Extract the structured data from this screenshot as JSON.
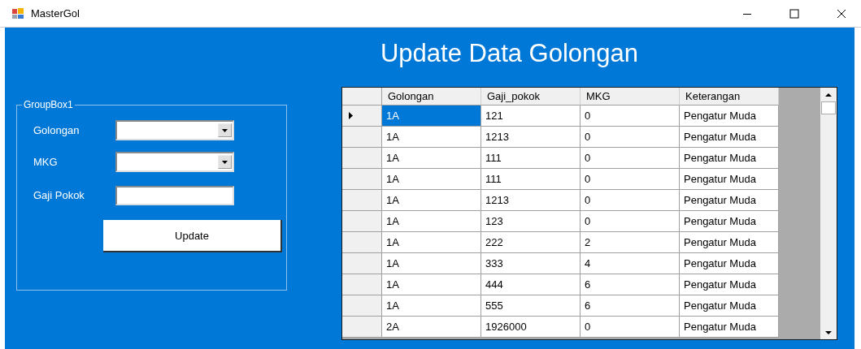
{
  "window": {
    "title": "MasterGol"
  },
  "heading": "Update Data Golongan",
  "group_box": {
    "title": "GroupBox1",
    "fields": [
      {
        "kind": "combo",
        "label": "Golongan"
      },
      {
        "kind": "combo",
        "label": "MKG"
      },
      {
        "kind": "text",
        "label": "Gaji Pokok"
      }
    ],
    "button": "Update"
  },
  "table": {
    "columns": [
      "Golongan",
      "Gaji_pokok",
      "MKG",
      "Keterangan"
    ],
    "rows": [
      {
        "selected": true,
        "cells": [
          "1A",
          "121",
          "0",
          "Pengatur Muda"
        ]
      },
      {
        "selected": false,
        "cells": [
          "1A",
          "1213",
          "0",
          "Pengatur Muda"
        ]
      },
      {
        "selected": false,
        "cells": [
          "1A",
          "111",
          "0",
          "Pengatur Muda"
        ]
      },
      {
        "selected": false,
        "cells": [
          "1A",
          "111",
          "0",
          "Pengatur Muda"
        ]
      },
      {
        "selected": false,
        "cells": [
          "1A",
          "1213",
          "0",
          "Pengatur Muda"
        ]
      },
      {
        "selected": false,
        "cells": [
          "1A",
          "123",
          "0",
          "Pengatur Muda"
        ]
      },
      {
        "selected": false,
        "cells": [
          "1A",
          "222",
          "2",
          "Pengatur Muda"
        ]
      },
      {
        "selected": false,
        "cells": [
          "1A",
          "333",
          "4",
          "Pengatur Muda"
        ]
      },
      {
        "selected": false,
        "cells": [
          "1A",
          "444",
          "6",
          "Pengatur Muda"
        ]
      },
      {
        "selected": false,
        "cells": [
          "1A",
          "555",
          "6",
          "Pengatur Muda"
        ]
      },
      {
        "selected": false,
        "cells": [
          "2A",
          "1926000",
          "0",
          "Pengatur Muda"
        ]
      }
    ]
  }
}
